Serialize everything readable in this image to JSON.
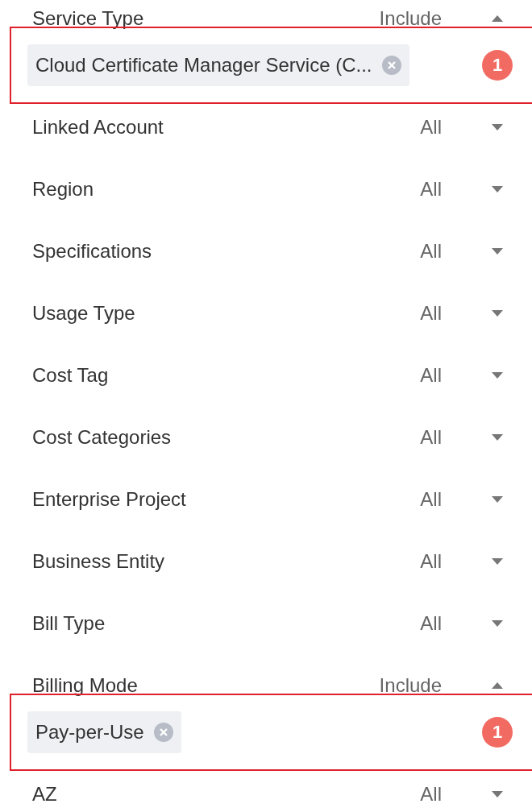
{
  "filters": [
    {
      "label": "Service Type",
      "value": "Include",
      "expanded": true,
      "selection": {
        "tags": [
          "Cloud Certificate Manager Service (C..."
        ],
        "badge": "1"
      }
    },
    {
      "label": "Linked Account",
      "value": "All",
      "expanded": false
    },
    {
      "label": "Region",
      "value": "All",
      "expanded": false
    },
    {
      "label": "Specifications",
      "value": "All",
      "expanded": false
    },
    {
      "label": "Usage Type",
      "value": "All",
      "expanded": false
    },
    {
      "label": "Cost Tag",
      "value": "All",
      "expanded": false
    },
    {
      "label": "Cost Categories",
      "value": "All",
      "expanded": false
    },
    {
      "label": "Enterprise Project",
      "value": "All",
      "expanded": false
    },
    {
      "label": "Business Entity",
      "value": "All",
      "expanded": false
    },
    {
      "label": "Bill Type",
      "value": "All",
      "expanded": false
    },
    {
      "label": "Billing Mode",
      "value": "Include",
      "expanded": true,
      "selection": {
        "tags": [
          "Pay-per-Use"
        ],
        "badge": "1"
      }
    },
    {
      "label": "AZ",
      "value": "All",
      "expanded": false
    }
  ]
}
